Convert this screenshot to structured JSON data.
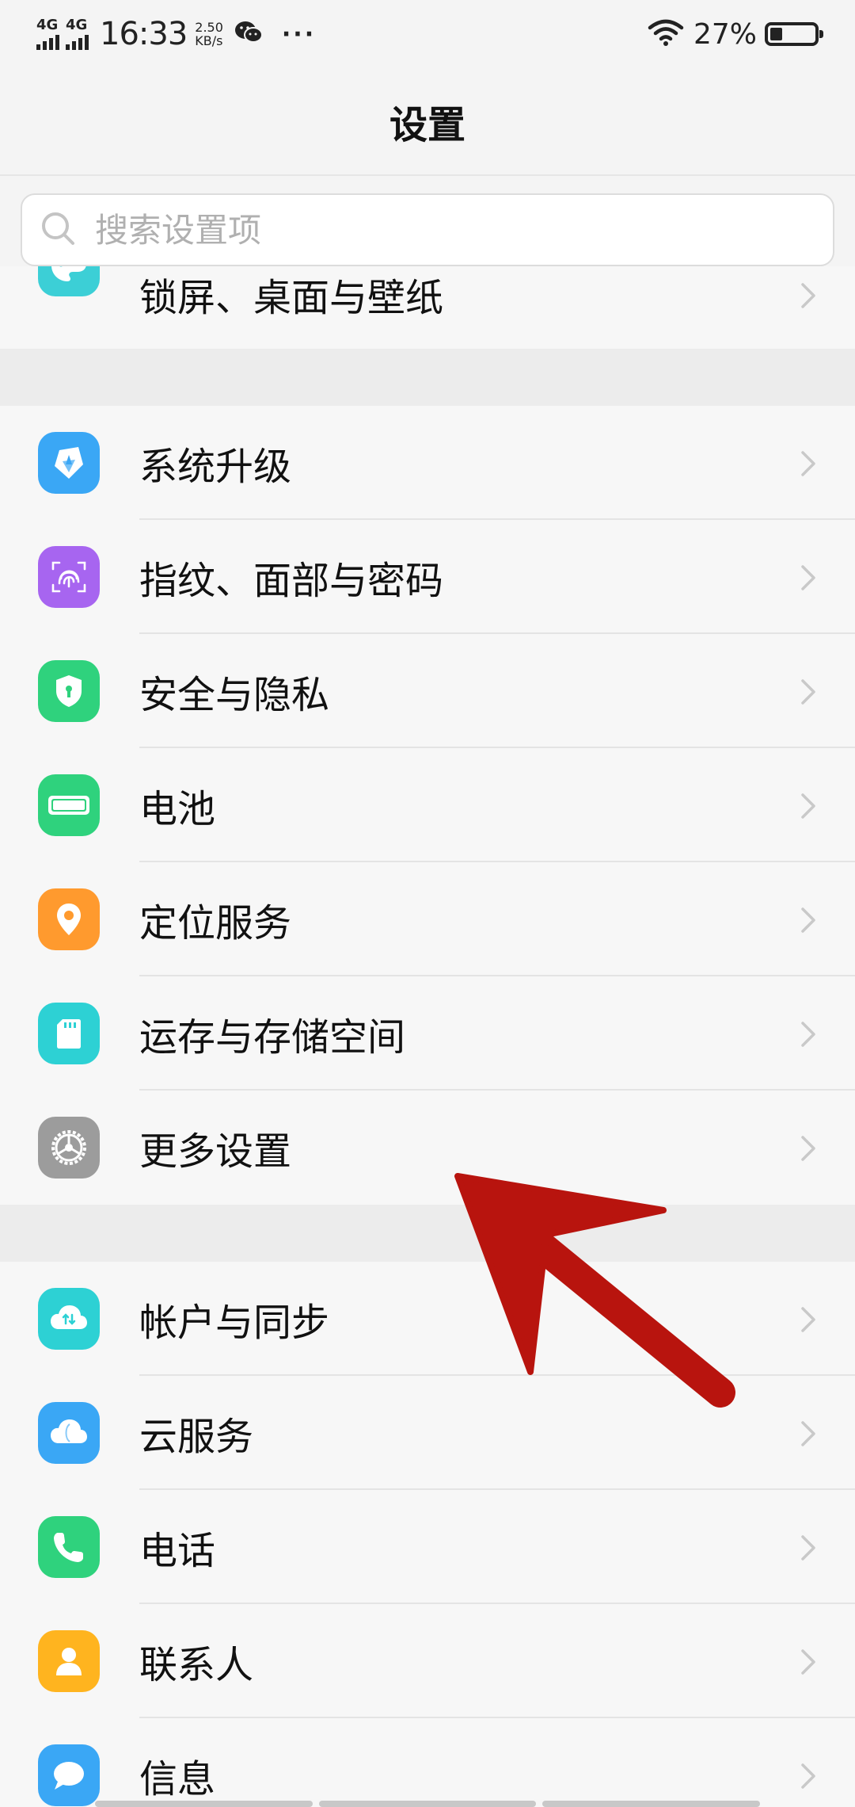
{
  "status_bar": {
    "network1": "4G",
    "network2": "4G",
    "time": "16:33",
    "speed_value": "2.50",
    "speed_unit": "KB/s",
    "overflow": "···",
    "battery_percent": "27%",
    "battery_level": 0.27
  },
  "header": {
    "title": "设置"
  },
  "search": {
    "placeholder": "搜索设置项",
    "value": ""
  },
  "list": {
    "partial_item": {
      "label": "锁屏、桌面与壁纸",
      "icon": "palette-icon",
      "color": "#3ccfd6"
    },
    "group1": [
      {
        "label": "系统升级",
        "icon": "upgrade-icon",
        "color": "#3aa7f5"
      },
      {
        "label": "指纹、面部与密码",
        "icon": "fingerprint-icon",
        "color": "#a765f0"
      },
      {
        "label": "安全与隐私",
        "icon": "shield-icon",
        "color": "#2fd27d"
      },
      {
        "label": "电池",
        "icon": "battery-icon",
        "color": "#2fd27d"
      },
      {
        "label": "定位服务",
        "icon": "location-pin-icon",
        "color": "#ff9a2e"
      },
      {
        "label": "运存与存储空间",
        "icon": "sd-card-icon",
        "color": "#2dd1d4"
      },
      {
        "label": "更多设置",
        "icon": "gear-icon",
        "color": "#9c9c9c"
      }
    ],
    "group2": [
      {
        "label": "帐户与同步",
        "icon": "sync-cloud-icon",
        "color": "#2dd1d4"
      },
      {
        "label": "云服务",
        "icon": "cloud-icon",
        "color": "#3aa7f5"
      },
      {
        "label": "电话",
        "icon": "phone-icon",
        "color": "#2fd27d"
      },
      {
        "label": "联系人",
        "icon": "contact-icon",
        "color": "#ffb41f"
      },
      {
        "label": "信息",
        "icon": "message-icon",
        "color": "#3aa7f5"
      }
    ]
  },
  "annotation": {
    "arrow_color": "#b8140e",
    "target": "更多设置"
  }
}
